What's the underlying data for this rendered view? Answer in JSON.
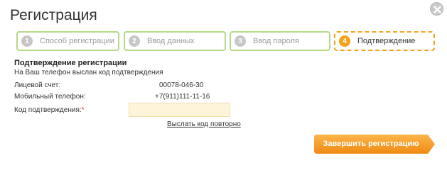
{
  "header": {
    "title": "Регистрация"
  },
  "steps": [
    {
      "num": "1",
      "label": "Способ регистрации",
      "active": false
    },
    {
      "num": "2",
      "label": "Ввод данных",
      "active": false
    },
    {
      "num": "3",
      "label": "Ввод пароля",
      "active": false
    },
    {
      "num": "4",
      "label": "Подтверждение",
      "active": true
    }
  ],
  "form": {
    "section_title": "Подтверждение регистрации",
    "note": "На Ваш телефон выслан код подтверждения",
    "account_label": "Лицевой счет:",
    "account_value": "00078-046-30",
    "phone_label": "Мобильный телефон:",
    "phone_value": "+7(911)111-11-16",
    "code_label": "Код подтверждения:",
    "code_required_mark": "*",
    "code_value": "",
    "resend_label": "Выслать код повторно"
  },
  "footer": {
    "submit_label": "Завершить регистрацию"
  },
  "colors": {
    "accent_orange": "#f2a31b",
    "step_border": "#b6d98a",
    "input_bg": "#fdf4d9",
    "required": "#e0332e"
  }
}
